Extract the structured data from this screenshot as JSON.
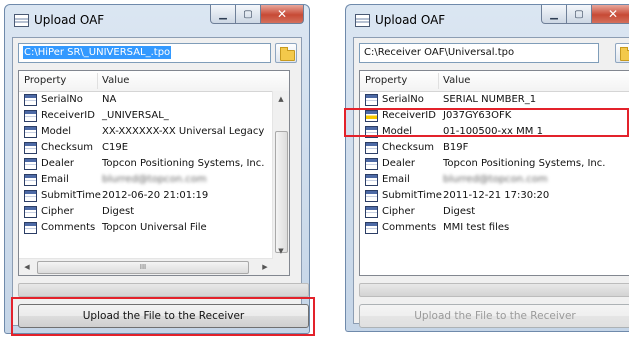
{
  "colors": {
    "highlight": "#e3222b",
    "selection": "#3399ff",
    "close_button": "#c74a35"
  },
  "left_window": {
    "title": "Upload OAF",
    "path": "C:\\HiPer SR\\_UNIVERSAL_.tpo",
    "columns": {
      "property": "Property",
      "value": "Value"
    },
    "rows": [
      {
        "property": "SerialNo",
        "value": "NA"
      },
      {
        "property": "ReceiverID",
        "value": "_UNIVERSAL_"
      },
      {
        "property": "Model",
        "value": "XX-XXXXXX-XX Universal Legacy"
      },
      {
        "property": "Checksum",
        "value": "C19E"
      },
      {
        "property": "Dealer",
        "value": "Topcon Positioning Systems, Inc."
      },
      {
        "property": "Email",
        "value": "blurred@topcon.com"
      },
      {
        "property": "SubmitTime",
        "value": "2012-06-20 21:01:19"
      },
      {
        "property": "Cipher",
        "value": "Digest"
      },
      {
        "property": "Comments",
        "value": "Topcon Universal File"
      }
    ],
    "hscroll_thumb": "III",
    "upload_button": "Upload the File to the Receiver"
  },
  "right_window": {
    "title": "Upload OAF",
    "path": "C:\\Receiver OAF\\Universal.tpo",
    "columns": {
      "property": "Property",
      "value": "Value"
    },
    "rows": [
      {
        "property": "SerialNo",
        "value": "SERIAL NUMBER_1"
      },
      {
        "property": "ReceiverID",
        "value": "J037GY63OFK"
      },
      {
        "property": "Model",
        "value": "01-100500-xx MM 1"
      },
      {
        "property": "Checksum",
        "value": "B19F"
      },
      {
        "property": "Dealer",
        "value": "Topcon Positioning Systems, Inc."
      },
      {
        "property": "Email",
        "value": "blurred@topcon.com"
      },
      {
        "property": "SubmitTime",
        "value": "2011-12-21 17:30:20"
      },
      {
        "property": "Cipher",
        "value": "Digest"
      },
      {
        "property": "Comments",
        "value": "MMI test files"
      }
    ],
    "upload_button": "Upload the File to the Receiver"
  }
}
